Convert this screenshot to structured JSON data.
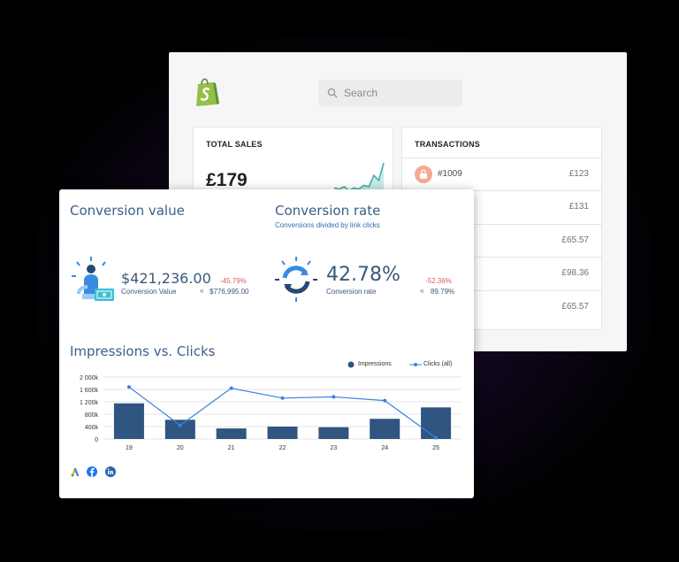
{
  "shopify": {
    "search_placeholder": "Search",
    "total_sales": {
      "label": "TOTAL SALES",
      "value": "£179",
      "trend": [
        4,
        3,
        5,
        2,
        4,
        3,
        6,
        5,
        14,
        10,
        24
      ]
    },
    "transactions": {
      "label": "TRANSACTIONS",
      "rows": [
        {
          "id": "#1009",
          "amount": "£123"
        },
        {
          "id": "",
          "amount": "£131"
        },
        {
          "id": "",
          "amount": "£65.57"
        },
        {
          "id": "",
          "amount": "£98.36"
        },
        {
          "id": "",
          "amount": "£65.57"
        }
      ]
    }
  },
  "dashboard": {
    "conversion_value": {
      "title": "Conversion value",
      "value": "$421,236.00",
      "label": "Conversion Value",
      "change": "-45.79%",
      "previous": "$776,995.00"
    },
    "conversion_rate": {
      "title": "Conversion rate",
      "subtitle": "Conversions divided by link clicks",
      "value": "42.78%",
      "label": "Conversion rate",
      "change": "-52.36%",
      "previous": "89.79%"
    },
    "chart_title": "Impressions vs. Clicks",
    "colors": {
      "bar": "#2f5580",
      "line": "#3d7fe0",
      "accent": "#2f6fb0",
      "negative": "#e05a57"
    },
    "sources": [
      "google-ads-icon",
      "facebook-icon",
      "linkedin-icon"
    ]
  },
  "chart_data": {
    "type": "bar",
    "title": "Impressions vs. Clicks",
    "categories": [
      "19",
      "20",
      "21",
      "22",
      "23",
      "24",
      "25"
    ],
    "ylim": [
      0,
      2000000
    ],
    "yticks": [
      "0",
      "400k",
      "800k",
      "1 200k",
      "1 600k",
      "2 000k"
    ],
    "legend_position": "top-right",
    "series": [
      {
        "name": "Impressions",
        "type": "bar",
        "values": [
          1150000,
          620000,
          340000,
          400000,
          380000,
          650000,
          1020000
        ]
      },
      {
        "name": "Clicks (all)",
        "type": "line",
        "values": [
          0.84,
          0.22,
          0.82,
          0.66,
          0.68,
          0.62,
          0.02
        ]
      }
    ]
  }
}
